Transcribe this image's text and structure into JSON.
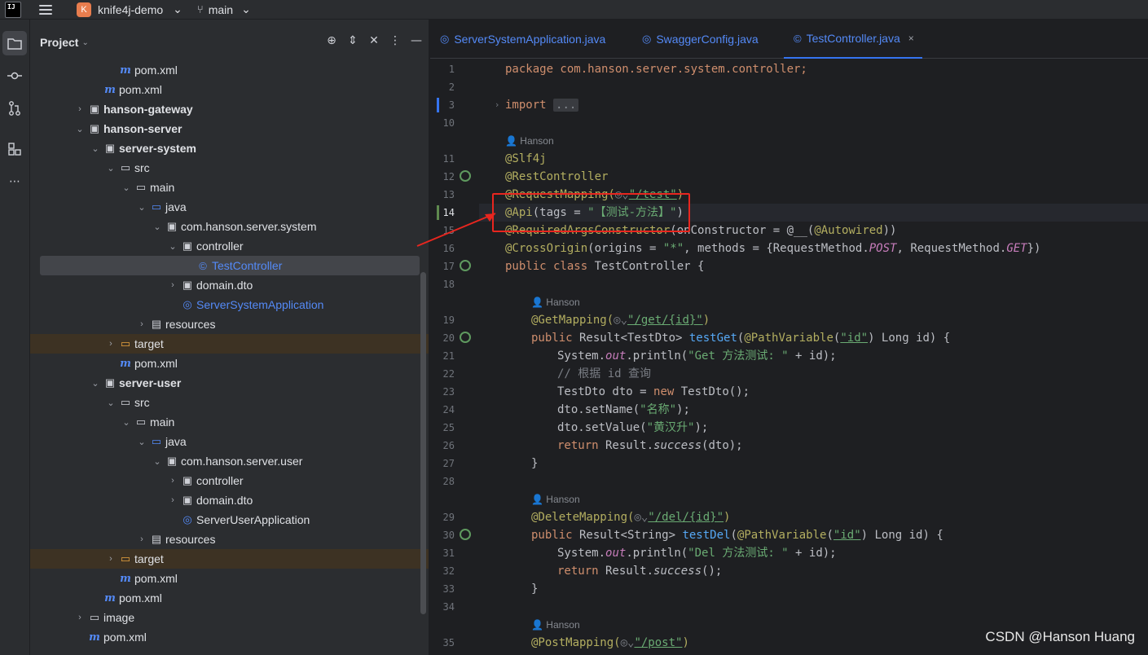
{
  "titlebar": {
    "app_logo": "IJ",
    "project_badge": "K",
    "project_name": "knife4j-demo",
    "branch": "main"
  },
  "project_panel": {
    "title": "Project",
    "tree": [
      {
        "label": "pom.xml",
        "icon": "maven-icon",
        "indent": 4
      },
      {
        "label": "pom.xml",
        "icon": "maven-icon",
        "indent": 3
      },
      {
        "label": "hanson-gateway",
        "icon": "module-folder-icon",
        "indent": 2,
        "arrow": "collapsed",
        "bold": true
      },
      {
        "label": "hanson-server",
        "icon": "module-folder-icon",
        "indent": 2,
        "arrow": "expanded",
        "bold": true
      },
      {
        "label": "server-system",
        "icon": "module-folder-icon",
        "indent": 3,
        "arrow": "expanded",
        "bold": true
      },
      {
        "label": "src",
        "icon": "folder-icon",
        "indent": 4,
        "arrow": "expanded"
      },
      {
        "label": "main",
        "icon": "folder-icon",
        "indent": 5,
        "arrow": "expanded"
      },
      {
        "label": "java",
        "icon": "source-folder-icon",
        "indent": 6,
        "arrow": "expanded"
      },
      {
        "label": "com.hanson.server.system",
        "icon": "package-icon",
        "indent": 7,
        "arrow": "expanded"
      },
      {
        "label": "controller",
        "icon": "package-icon",
        "indent": 8,
        "arrow": "expanded"
      },
      {
        "label": "TestController",
        "icon": "class-icon",
        "indent": 9,
        "selected": true,
        "blue": true
      },
      {
        "label": "domain.dto",
        "icon": "package-icon",
        "indent": 8,
        "arrow": "collapsed"
      },
      {
        "label": "ServerSystemApplication",
        "icon": "spring-class-icon",
        "indent": 8,
        "blue": true
      },
      {
        "label": "resources",
        "icon": "resources-folder-icon",
        "indent": 6,
        "arrow": "collapsed"
      },
      {
        "label": "target",
        "icon": "excluded-folder-icon",
        "indent": 4,
        "arrow": "collapsed",
        "excluded": true
      },
      {
        "label": "pom.xml",
        "icon": "maven-icon",
        "indent": 4
      },
      {
        "label": "server-user",
        "icon": "module-folder-icon",
        "indent": 3,
        "arrow": "expanded",
        "bold": true
      },
      {
        "label": "src",
        "icon": "folder-icon",
        "indent": 4,
        "arrow": "expanded"
      },
      {
        "label": "main",
        "icon": "folder-icon",
        "indent": 5,
        "arrow": "expanded"
      },
      {
        "label": "java",
        "icon": "source-folder-icon",
        "indent": 6,
        "arrow": "expanded"
      },
      {
        "label": "com.hanson.server.user",
        "icon": "package-icon",
        "indent": 7,
        "arrow": "expanded"
      },
      {
        "label": "controller",
        "icon": "package-icon",
        "indent": 8,
        "arrow": "collapsed"
      },
      {
        "label": "domain.dto",
        "icon": "package-icon",
        "indent": 8,
        "arrow": "collapsed"
      },
      {
        "label": "ServerUserApplication",
        "icon": "spring-class-icon",
        "indent": 8
      },
      {
        "label": "resources",
        "icon": "resources-folder-icon",
        "indent": 6,
        "arrow": "collapsed"
      },
      {
        "label": "target",
        "icon": "excluded-folder-icon",
        "indent": 4,
        "arrow": "collapsed",
        "excluded": true
      },
      {
        "label": "pom.xml",
        "icon": "maven-icon",
        "indent": 4
      },
      {
        "label": "pom.xml",
        "icon": "maven-icon",
        "indent": 3
      },
      {
        "label": "image",
        "icon": "folder-icon",
        "indent": 2,
        "arrow": "collapsed"
      },
      {
        "label": "pom.xml",
        "icon": "maven-icon",
        "indent": 2
      }
    ]
  },
  "tabs": [
    {
      "label": "ServerSystemApplication.java",
      "icon": "spring-class-icon"
    },
    {
      "label": "SwaggerConfig.java",
      "icon": "spring-class-icon"
    },
    {
      "label": "TestController.java",
      "icon": "class-icon",
      "active": true
    }
  ],
  "gutter_numbers": [
    "1",
    "2",
    "3",
    "10",
    "",
    "11",
    "12",
    "13",
    "14",
    "15",
    "16",
    "17",
    "18",
    "",
    "19",
    "20",
    "21",
    "22",
    "23",
    "24",
    "25",
    "26",
    "27",
    "28",
    "",
    "29",
    "30",
    "31",
    "32",
    "33",
    "34",
    "",
    "35"
  ],
  "author": "Hanson",
  "code": {
    "l1": "package com.hanson.server.system.controller;",
    "l3_kw": "import",
    "l3_fold": "...",
    "l11": "@Slf4j",
    "l12": "@RestController",
    "l13_a": "@RequestMapping(",
    "l13_s": "\"/test\"",
    "l13_b": ")",
    "l14_a": "@Api",
    "l14_b": "(tags = ",
    "l14_s": "\"【测试-方法】\"",
    "l14_c": ")",
    "l15_a": "@RequiredArgsConstructor",
    "l15_b": "(onConstructor = @__(",
    "l15_c": "@Autowired",
    "l15_d": "))",
    "l16_a": "@CrossOrigin",
    "l16_b": "(origins = ",
    "l16_s": "\"*\"",
    "l16_c": ", methods = {RequestMethod.",
    "l16_d": "POST",
    "l16_e": ", RequestMethod.",
    "l16_f": "GET",
    "l16_g": "})",
    "l17_k": "public class",
    "l17_b": " TestController {",
    "l19_a": "@GetMapping(",
    "l19_s": "\"/get/{id}\"",
    "l19_b": ")",
    "l20_k": "public",
    "l20_b": " Result<TestDto> ",
    "l20_m": "testGet",
    "l20_c": "(",
    "l20_an": "@PathVariable",
    "l20_d": "(",
    "l20_s": "\"id\"",
    "l20_e": ") Long id) {",
    "l21_a": "System.",
    "l21_o": "out",
    "l21_b": ".println(",
    "l21_s": "\"Get 方法测试: \"",
    "l21_c": " + id);",
    "l22": "// 根据 id 查询",
    "l23_a": "TestDto dto = ",
    "l23_k": "new",
    "l23_b": " TestDto();",
    "l24_a": "dto.setName(",
    "l24_s": "\"名称\"",
    "l24_b": ");",
    "l25_a": "dto.setValue(",
    "l25_s": "\"黄汉升\"",
    "l25_b": ");",
    "l26_k": "return",
    "l26_a": " Result.",
    "l26_f": "success",
    "l26_b": "(dto);",
    "l27": "}",
    "l29_a": "@DeleteMapping(",
    "l29_s": "\"/del/{id}\"",
    "l29_b": ")",
    "l30_k": "public",
    "l30_b": " Result<String> ",
    "l30_m": "testDel",
    "l30_c": "(",
    "l30_an": "@PathVariable",
    "l30_d": "(",
    "l30_s": "\"id\"",
    "l30_e": ") Long id) {",
    "l31_a": "System.",
    "l31_o": "out",
    "l31_b": ".println(",
    "l31_s": "\"Del 方法测试: \"",
    "l31_c": " + id);",
    "l32_k": "return",
    "l32_a": " Result.",
    "l32_f": "success",
    "l32_b": "();",
    "l33": "}",
    "l35_a": "@PostMapping(",
    "l35_s": "\"/post\"",
    "l35_b": ")"
  },
  "watermark": "CSDN @Hanson Huang",
  "colors": {
    "keyword": "#cf8e6d",
    "annotation": "#b3ae60",
    "string": "#6aab73",
    "method": "#56a8f5",
    "highlight_box": "#e8261f"
  }
}
